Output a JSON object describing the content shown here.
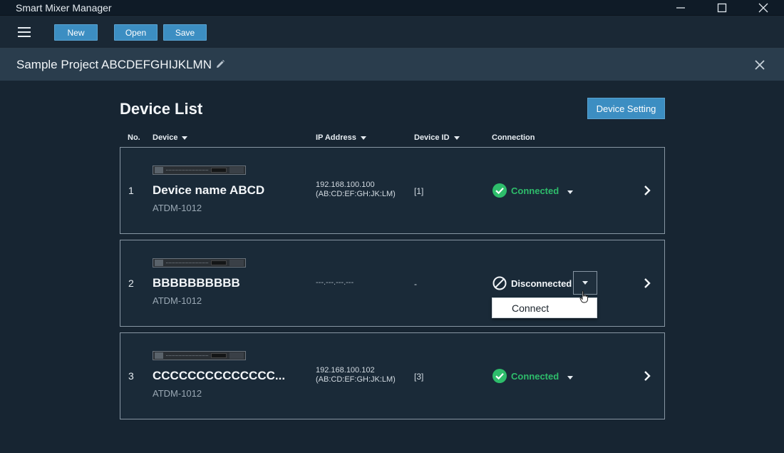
{
  "app": {
    "title": "Smart Mixer Manager"
  },
  "toolbar": {
    "new_label": "New",
    "open_label": "Open",
    "save_label": "Save"
  },
  "project": {
    "name": "Sample Project ABCDEFGHIJKLMN"
  },
  "main": {
    "title": "Device List",
    "device_setting_label": "Device Setting",
    "columns": {
      "no": "No.",
      "device": "Device",
      "ip": "IP Address",
      "device_id": "Device ID",
      "connection": "Connection"
    }
  },
  "devices": [
    {
      "no": "1",
      "name": "Device name ABCD",
      "model": "ATDM-1012",
      "ip": "192.168.100.100",
      "mac": "(AB:CD:EF:GH:JK:LM)",
      "device_id": "[1]",
      "connection": "Connected"
    },
    {
      "no": "2",
      "name": "BBBBBBBBBB",
      "model": "ATDM-1012",
      "ip": "---.---.---.---",
      "device_id": "-",
      "connection": "Disconnected"
    },
    {
      "no": "3",
      "name": "CCCCCCCCCCCCCC...",
      "model": "ATDM-1012",
      "ip": "192.168.100.102",
      "mac": "(AB:CD:EF:GH:JK:LM)",
      "device_id": "[3]",
      "connection": "Connected"
    }
  ],
  "connection_menu": {
    "option": "Connect"
  },
  "colors": {
    "accent_button": "#3c8ec2",
    "connected_green": "#2ebd6b",
    "background": "#172532"
  },
  "icons": {
    "menu": "hamburger-menu-icon",
    "edit": "pencil-icon",
    "close": "close-icon",
    "connected": "check-circle-icon",
    "disconnected": "prohibited-circle-icon",
    "row_nav": "chevron-right-icon",
    "dropdown": "caret-down-icon",
    "pointer": "hand-pointer-icon"
  }
}
